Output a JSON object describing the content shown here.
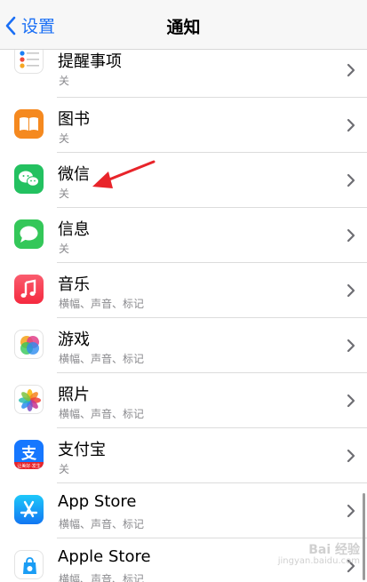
{
  "nav": {
    "back_label": "设置",
    "title": "通知"
  },
  "items": [
    {
      "title": "提醒事项",
      "subtitle": "关"
    },
    {
      "title": "图书",
      "subtitle": "关"
    },
    {
      "title": "微信",
      "subtitle": "关"
    },
    {
      "title": "信息",
      "subtitle": "关"
    },
    {
      "title": "音乐",
      "subtitle": "横幅、声音、标记"
    },
    {
      "title": "游戏",
      "subtitle": "横幅、声音、标记"
    },
    {
      "title": "照片",
      "subtitle": "横幅、声音、标记"
    },
    {
      "title": "支付宝",
      "subtitle": "关",
      "icon_badge": "让美好·发生"
    },
    {
      "title": "App Store",
      "subtitle": "横幅、声音、标记"
    },
    {
      "title": "Apple Store",
      "subtitle": "横幅、声音、标记"
    }
  ],
  "icons": [
    "reminders-icon",
    "books-icon",
    "wechat-icon",
    "messages-icon",
    "music-icon",
    "game-center-icon",
    "photos-icon",
    "alipay-icon",
    "app-store-icon",
    "apple-store-icon"
  ],
  "colors": {
    "accent": "#1a6ff5",
    "annotation": "#e8242a"
  },
  "watermark": {
    "text": "Bai 经验",
    "url": "jingyan.baidu.com"
  }
}
